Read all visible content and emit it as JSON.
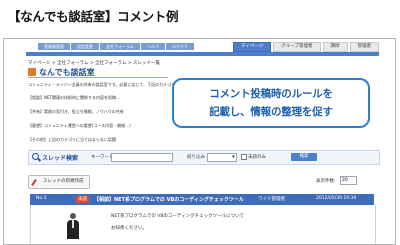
{
  "heading": "【なんでも談話室】コメント例",
  "nav_left": [
    "登録者管理",
    "設定変更",
    "全社フォーラム",
    "ヘルプ",
    "ログオフ"
  ],
  "nav_right": [
    {
      "label": "マイページ",
      "active": true
    },
    {
      "label": "グループ管理者",
      "active": false
    },
    {
      "label": "講師",
      "active": false
    },
    {
      "label": "管理者",
      "active": false
    }
  ],
  "breadcrumb": "マイページ > 全社フォーラム > 全社フォーラム > スレッド一覧",
  "page_title": "なんでも談話室",
  "description_lines": [
    "コミュニティ・メンバー全員の共有の談話室です。必要に応じて、下記のカテゴリ…",
    "【相談】NET関連の技術的に関係する内容を投稿…",
    "【共有】実践の気付き、役立ち情報、ノウハウの共有",
    "【要望】コミュニティ運営への要望(コース内容・開催…)",
    "【その他】上記のカテゴリに当てはまらない話題"
  ],
  "search": {
    "title": "スレッド検索",
    "keyword_label": "キーワード",
    "category_label": "絞り込み",
    "checkbox_label": "未読のみ",
    "button_label": "検索"
  },
  "new_thread_label": "スレッドの新規作成",
  "display_count_label": "表示件数:",
  "display_count_value": "20",
  "thread": {
    "number": "No.3",
    "tag": "未読",
    "title": "【相談】NET系プログラムでの VBのコーディングチェックツール",
    "user": "ワイド管理者",
    "date": "2012/05/30 19:39",
    "body_lines": [
      "NET系プログラムでの VBのコーディングチェックツールについて",
      "お知恵ください。"
    ]
  },
  "callout": {
    "line1": "コメント投稿時のルールを",
    "line2": "記載し、情報の整理を促す"
  }
}
